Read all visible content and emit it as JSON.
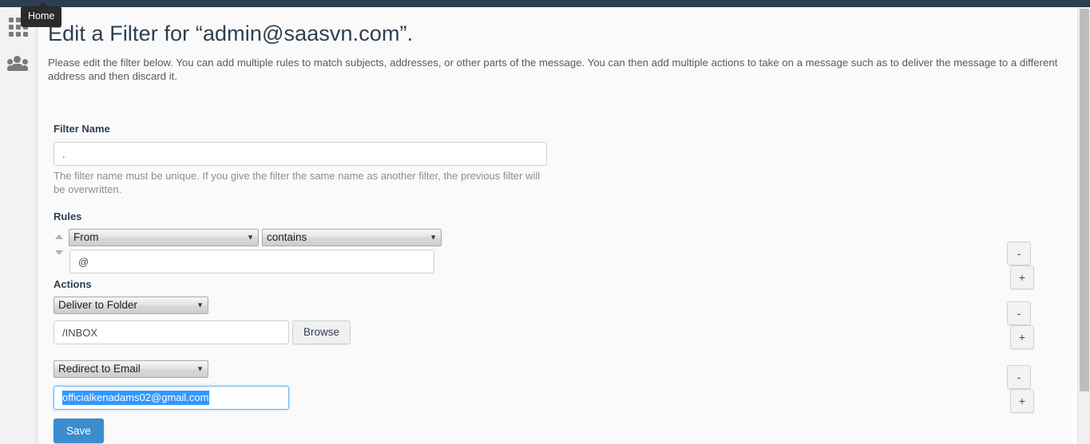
{
  "window": {
    "topbar_color": "#2c3e50",
    "page_bg": "#fafafa"
  },
  "sidebar": {
    "items": [
      {
        "icon": "grid-icon",
        "label": "Home"
      },
      {
        "icon": "people-icon",
        "label": "Users"
      }
    ],
    "tooltip": "Home"
  },
  "header": {
    "title": "Edit a Filter for “admin@saasvn.com”.",
    "description": "Please edit the filter below. You can add multiple rules to match subjects, addresses, or other parts of the message. You can then add multiple actions to take on a message such as to deliver the message to a different address and then discard it."
  },
  "filter_name": {
    "label": "Filter Name",
    "value": ".",
    "placeholder": "",
    "help": "The filter name must be unique. If you give the filter the same name as another filter, the previous filter will be overwritten."
  },
  "rules": {
    "label": "Rules",
    "rows": [
      {
        "field_select": "From",
        "match_select": "contains",
        "value": "@",
        "value_placeholder": "",
        "remove_label": "-",
        "add_label": "+",
        "sort_up": "▲",
        "sort_down": "▼"
      }
    ]
  },
  "actions": {
    "label": "Actions",
    "rows": [
      {
        "action_select": "Deliver to Folder",
        "value": "/INBOX",
        "browse_label": "Browse",
        "remove_label": "-",
        "add_label": "+",
        "focused": false
      },
      {
        "action_select": "Redirect to Email",
        "value": "officialkenadams02@gmail.com",
        "remove_label": "-",
        "add_label": "+",
        "focused": true
      }
    ]
  },
  "footer": {
    "save_label": "Save"
  },
  "colors": {
    "accent": "#3b8dce",
    "selection": "#3297fd",
    "topbar": "#2c3e50",
    "title_text": "#2e3f4f"
  }
}
